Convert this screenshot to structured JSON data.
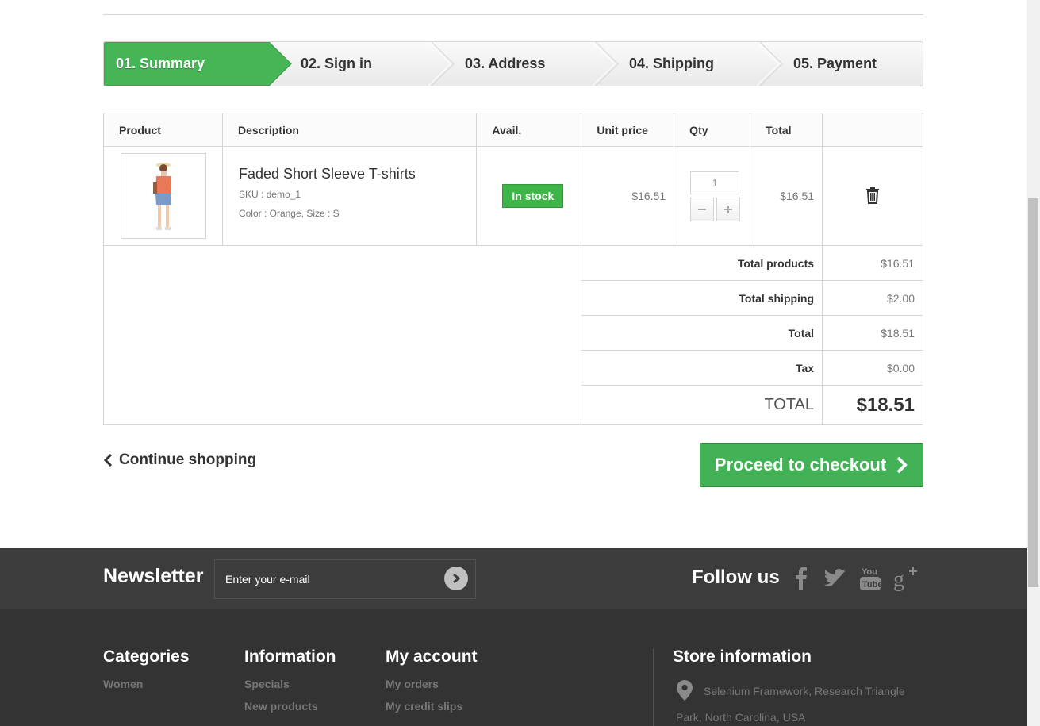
{
  "steps": [
    {
      "label": "01. Summary",
      "active": true
    },
    {
      "label": "02. Sign in",
      "active": false
    },
    {
      "label": "03. Address",
      "active": false
    },
    {
      "label": "04. Shipping",
      "active": false
    },
    {
      "label": "05. Payment",
      "active": false
    }
  ],
  "cart": {
    "headers": {
      "product": "Product",
      "description": "Description",
      "avail": "Avail.",
      "unit_price": "Unit price",
      "qty": "Qty",
      "total": "Total"
    },
    "item": {
      "name": "Faded Short Sleeve T-shirts",
      "sku": "SKU : demo_1",
      "attributes": "Color : Orange, Size : S",
      "availability": "In stock",
      "unit_price": "$16.51",
      "quantity": "1",
      "total": "$16.51"
    },
    "summary": {
      "total_products_label": "Total products",
      "total_products": "$16.51",
      "total_shipping_label": "Total shipping",
      "total_shipping": "$2.00",
      "total_label": "Total",
      "total": "$18.51",
      "tax_label": "Tax",
      "tax": "$0.00",
      "grand_total_label": "TOTAL",
      "grand_total": "$18.51"
    }
  },
  "actions": {
    "continue_shopping": "Continue shopping",
    "proceed_checkout": "Proceed to checkout"
  },
  "newsletter": {
    "title": "Newsletter",
    "placeholder": "Enter your e-mail"
  },
  "follow": {
    "title": "Follow us",
    "networks": [
      "facebook-icon",
      "twitter-icon",
      "youtube-icon",
      "google-plus-icon"
    ]
  },
  "footer": {
    "categories": {
      "title": "Categories",
      "links": [
        "Women"
      ]
    },
    "information": {
      "title": "Information",
      "links": [
        "Specials",
        "New products"
      ]
    },
    "my_account": {
      "title": "My account",
      "links": [
        "My orders",
        "My credit slips"
      ]
    },
    "store": {
      "title": "Store information",
      "address_line1": "Selenium Framework, Research Triangle",
      "address_line2": "Park, North Carolina, USA"
    }
  },
  "colors": {
    "accent_green": "#3fb549",
    "footer_dark": "#333333",
    "footer_bar": "#3c3c3c"
  }
}
